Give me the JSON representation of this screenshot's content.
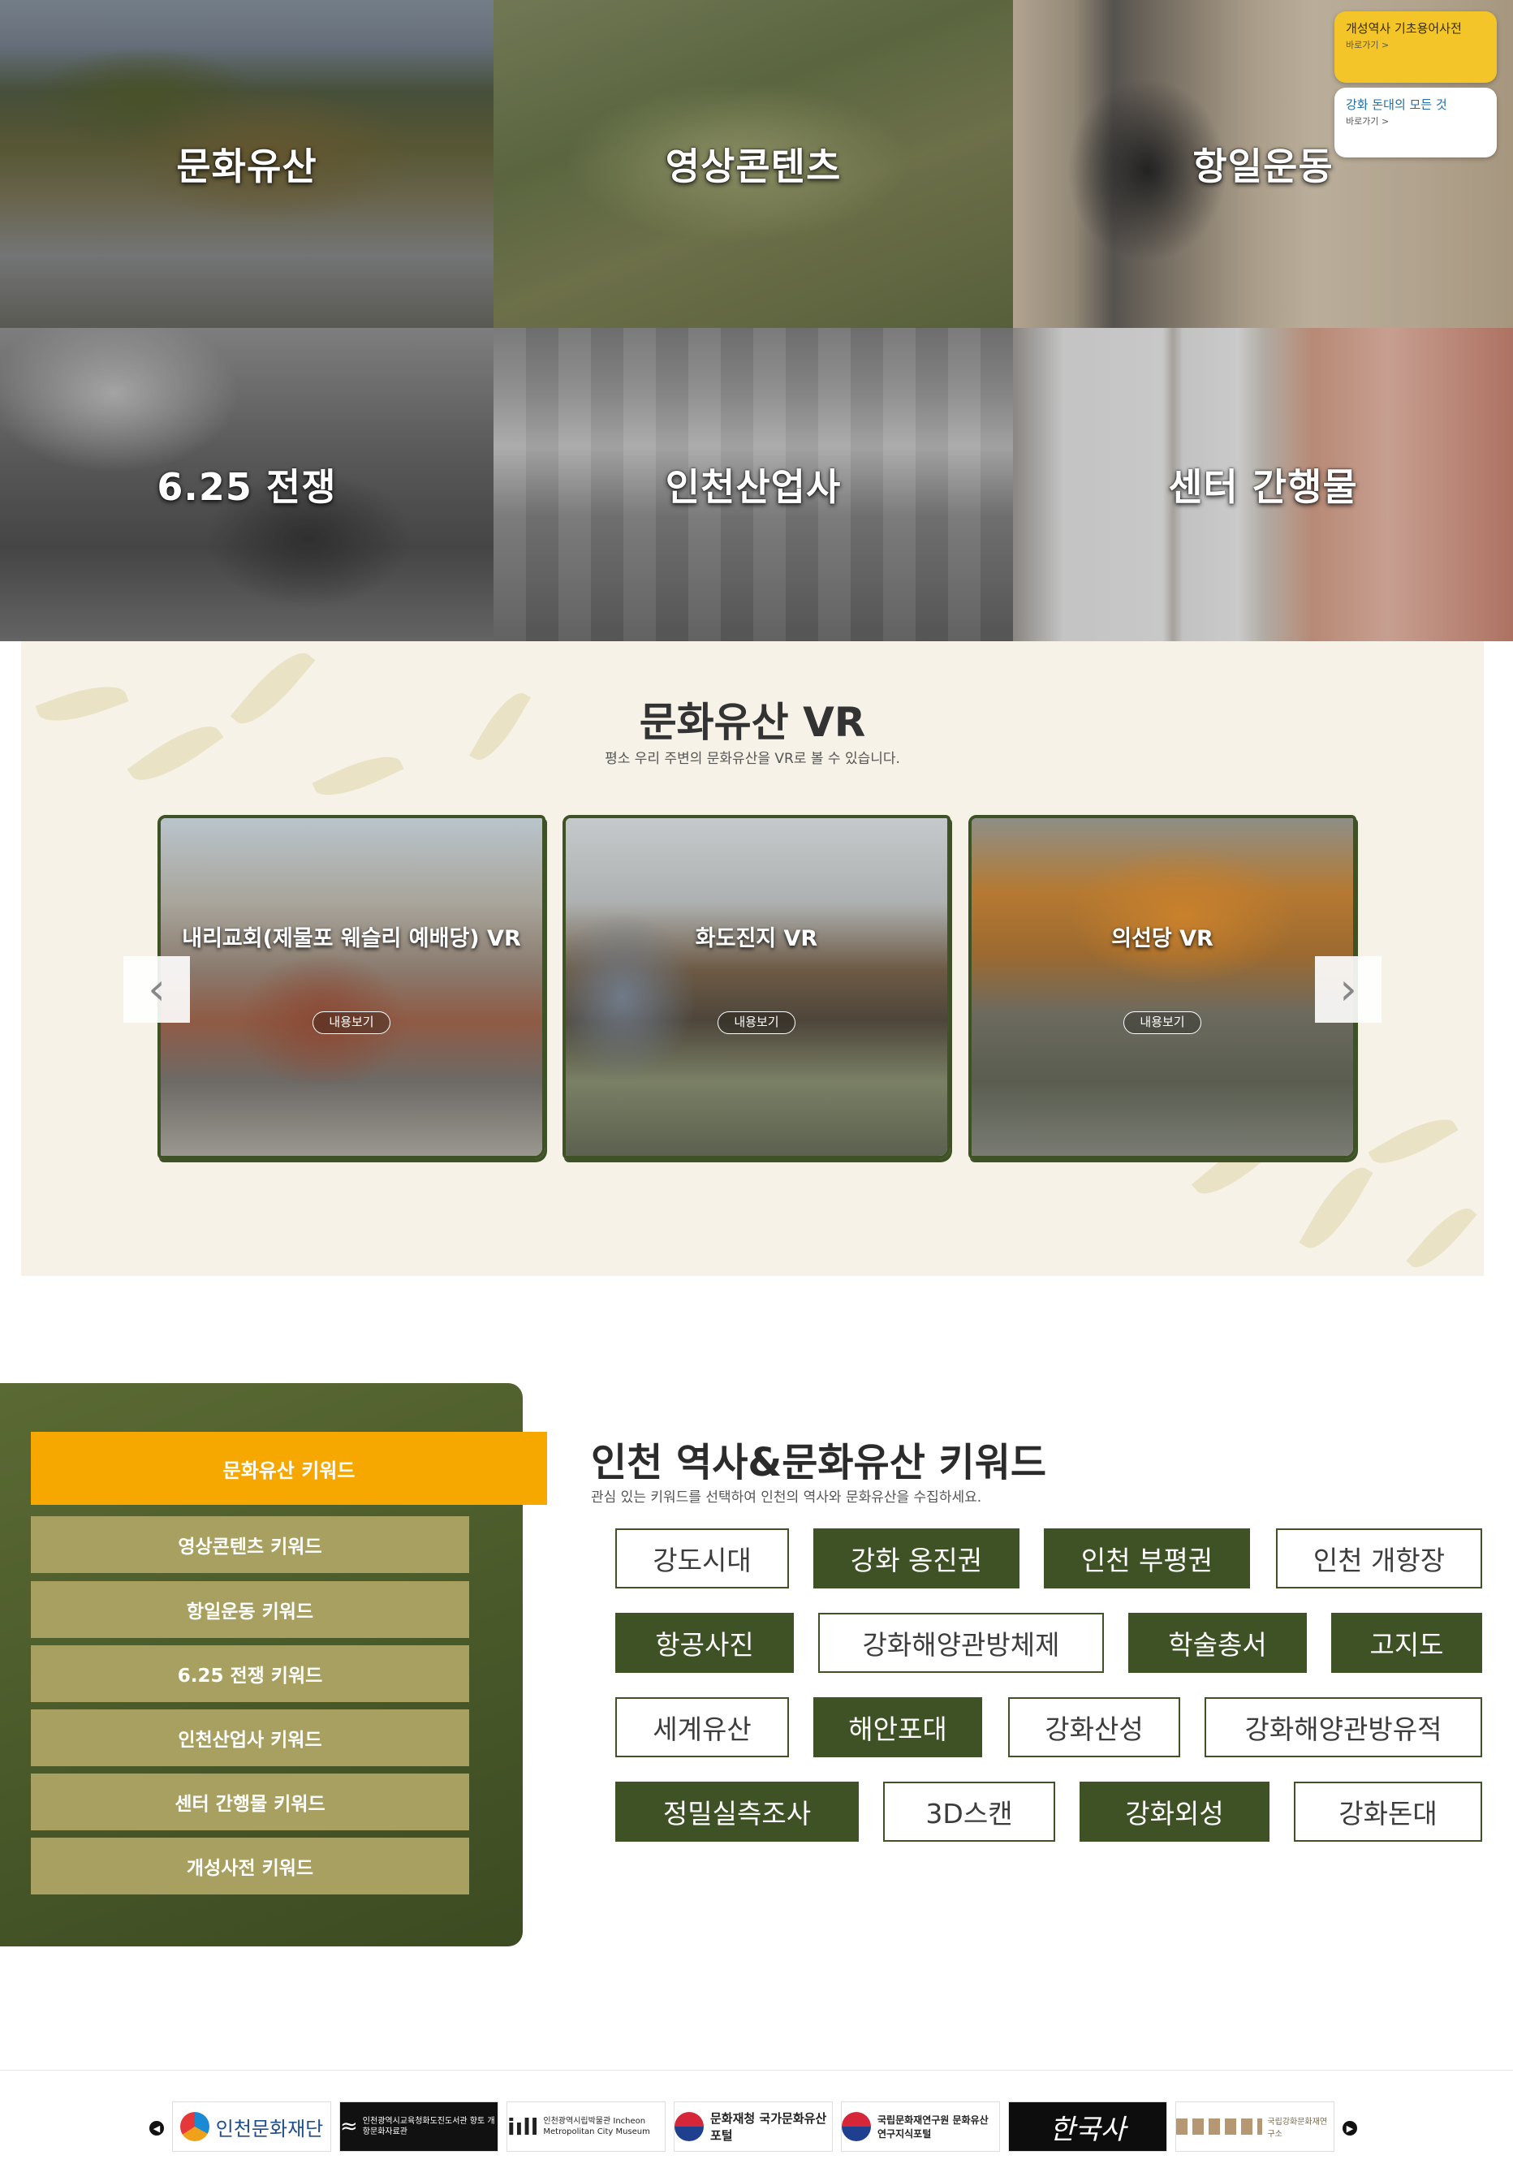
{
  "categories": [
    {
      "label": "문화유산"
    },
    {
      "label": "영상콘텐츠"
    },
    {
      "label": "항일운동"
    },
    {
      "label": "6.25 전쟁"
    },
    {
      "label": "인천산업사"
    },
    {
      "label": "센터 간행물"
    }
  ],
  "quick_banner": {
    "item1": {
      "title": "개성역사 기초용어사전",
      "more": "바로가기 >"
    },
    "item2": {
      "title": "강화 돈대의 모든 것",
      "more": "바로가기 >"
    }
  },
  "vr": {
    "title": "문화유산 VR",
    "subtitle": "평소 우리 주변의 문화유산을 VR로 볼 수 있습니다.",
    "cards": [
      {
        "title": "내리교회(제물포 웨슬리 예배당) VR",
        "button": "내용보기"
      },
      {
        "title": "화도진지 VR",
        "button": "내용보기"
      },
      {
        "title": "의선당 VR",
        "button": "내용보기"
      }
    ],
    "prev_icon": "chevron-left-icon",
    "next_icon": "chevron-right-icon"
  },
  "keywords": {
    "title": "인천 역사&문화유산 키워드",
    "description": "관심 있는 키워드를 선택하여 인천의 역사와 문화유산을 수집하세요.",
    "tabs": [
      {
        "label": "문화유산 키워드",
        "active": true
      },
      {
        "label": "영상콘텐츠 키워드"
      },
      {
        "label": "항일운동 키워드"
      },
      {
        "label": "6.25 전쟁 키워드"
      },
      {
        "label": "인천산업사 키워드"
      },
      {
        "label": "센터 간행물 키워드"
      },
      {
        "label": "개성사전 키워드"
      }
    ],
    "items": [
      {
        "label": "강도시대",
        "style": "outline"
      },
      {
        "label": "강화 옹진권",
        "style": "filled"
      },
      {
        "label": "인천 부평권",
        "style": "filled"
      },
      {
        "label": "인천 개항장",
        "style": "outline"
      },
      {
        "label": "항공사진",
        "style": "filled"
      },
      {
        "label": "강화해양관방체제",
        "style": "outline"
      },
      {
        "label": "학술총서",
        "style": "filled"
      },
      {
        "label": "고지도",
        "style": "filled"
      },
      {
        "label": "세계유산",
        "style": "outline"
      },
      {
        "label": "해안포대",
        "style": "filled"
      },
      {
        "label": "강화산성",
        "style": "outline"
      },
      {
        "label": "강화해양관방유적",
        "style": "outline"
      },
      {
        "label": "정밀실측조사",
        "style": "filled"
      },
      {
        "label": "3D스캔",
        "style": "outline"
      },
      {
        "label": "강화외성",
        "style": "filled"
      },
      {
        "label": "강화돈대",
        "style": "outline"
      }
    ]
  },
  "footer": {
    "logos": [
      {
        "label": "인천문화재단"
      },
      {
        "label": "인천광역시교육청화도진도서관 향토 개항문화자료관"
      },
      {
        "label": "인천광역시립박물관 Incheon Metropolitan City Museum"
      },
      {
        "label": "문화재청 국가문화유산포털"
      },
      {
        "label": "국립문화재연구원 문화유산 연구지식포털"
      },
      {
        "label": "한국사"
      },
      {
        "label": "국립강화문화재연구소"
      }
    ],
    "prev_icon": "chevron-left-icon",
    "next_icon": "chevron-right-icon"
  }
}
